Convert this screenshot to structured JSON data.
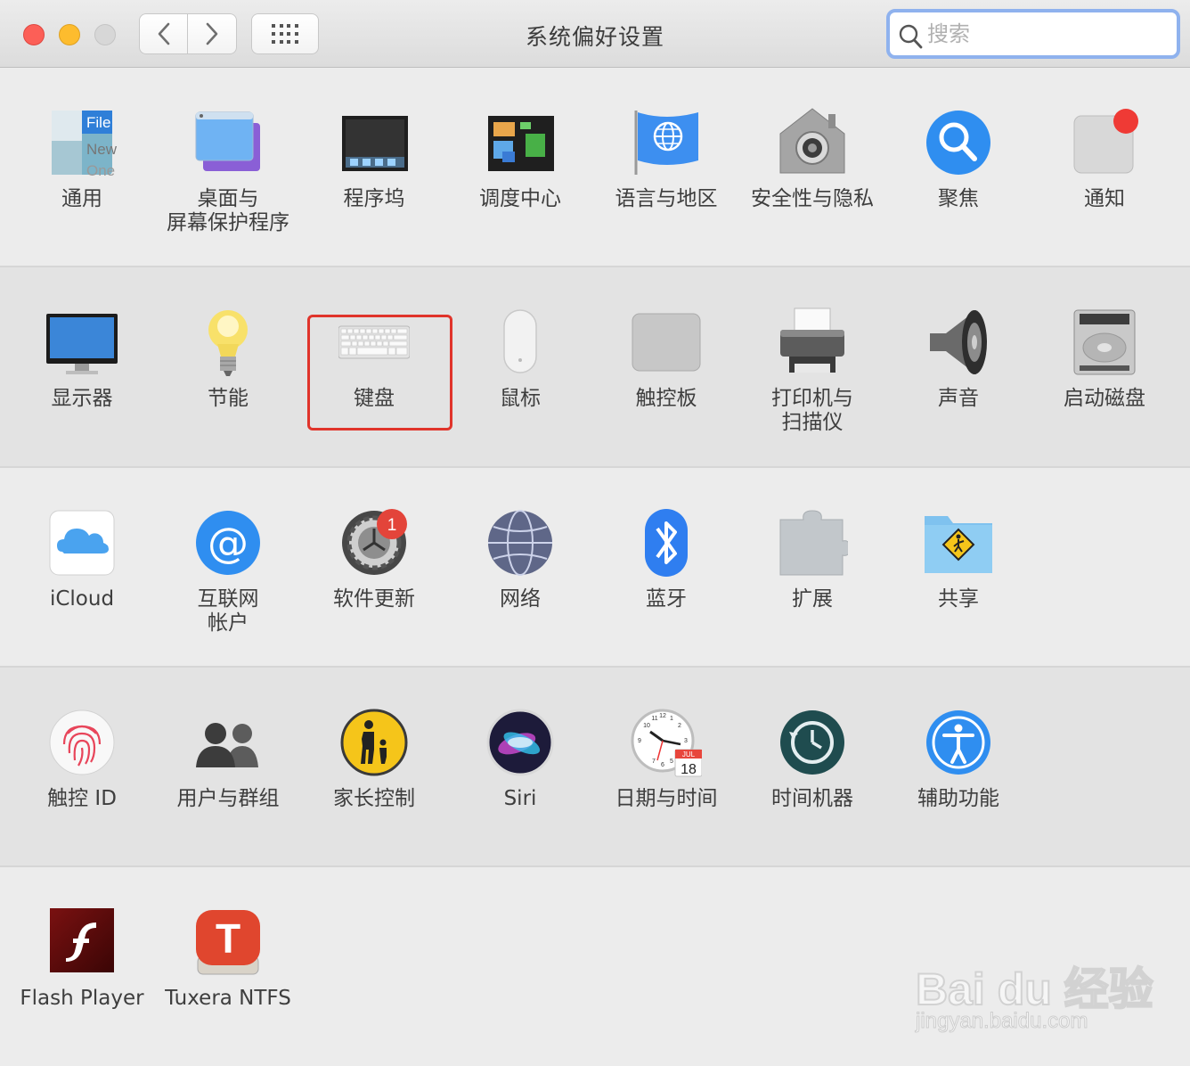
{
  "window": {
    "title": "系统偏好设置",
    "search_placeholder": "搜索"
  },
  "rows": [
    [
      {
        "label": "通用",
        "icon": "general-icon"
      },
      {
        "label": "桌面与\n屏幕保护程序",
        "icon": "desktop-screensaver-icon"
      },
      {
        "label": "程序坞",
        "icon": "dock-icon"
      },
      {
        "label": "调度中心",
        "icon": "mission-control-icon"
      },
      {
        "label": "语言与地区",
        "icon": "language-region-icon"
      },
      {
        "label": "安全性与隐私",
        "icon": "security-privacy-icon"
      },
      {
        "label": "聚焦",
        "icon": "spotlight-icon"
      },
      {
        "label": "通知",
        "icon": "notifications-icon"
      }
    ],
    [
      {
        "label": "显示器",
        "icon": "displays-icon"
      },
      {
        "label": "节能",
        "icon": "energy-saver-icon"
      },
      {
        "label": "键盘",
        "icon": "keyboard-icon"
      },
      {
        "label": "鼠标",
        "icon": "mouse-icon"
      },
      {
        "label": "触控板",
        "icon": "trackpad-icon"
      },
      {
        "label": "打印机与\n扫描仪",
        "icon": "printers-scanners-icon"
      },
      {
        "label": "声音",
        "icon": "sound-icon"
      },
      {
        "label": "启动磁盘",
        "icon": "startup-disk-icon"
      }
    ],
    [
      {
        "label": "iCloud",
        "icon": "icloud-icon"
      },
      {
        "label": "互联网\n帐户",
        "icon": "internet-accounts-icon"
      },
      {
        "label": "软件更新",
        "icon": "software-update-icon",
        "badge": "1"
      },
      {
        "label": "网络",
        "icon": "network-icon"
      },
      {
        "label": "蓝牙",
        "icon": "bluetooth-icon"
      },
      {
        "label": "扩展",
        "icon": "extensions-icon"
      },
      {
        "label": "共享",
        "icon": "sharing-icon"
      }
    ],
    [
      {
        "label": "触控 ID",
        "icon": "touch-id-icon"
      },
      {
        "label": "用户与群组",
        "icon": "users-groups-icon"
      },
      {
        "label": "家长控制",
        "icon": "parental-controls-icon"
      },
      {
        "label": "Siri",
        "icon": "siri-icon"
      },
      {
        "label": "日期与时间",
        "icon": "date-time-icon"
      },
      {
        "label": "时间机器",
        "icon": "time-machine-icon"
      },
      {
        "label": "辅助功能",
        "icon": "accessibility-icon"
      }
    ],
    [
      {
        "label": "Flash Player",
        "icon": "flash-player-icon"
      },
      {
        "label": "Tuxera NTFS",
        "icon": "tuxera-ntfs-icon"
      }
    ]
  ],
  "icon_text": {
    "general_lines": [
      "File",
      "New",
      "One"
    ],
    "calendar_month": "JUL",
    "calendar_day": "18",
    "clock_numbers": [
      "11",
      "12",
      "1",
      "10",
      "2",
      "9",
      "3",
      "7",
      "6",
      "5"
    ]
  },
  "highlighted_pane": "keyboard-icon",
  "watermark": {
    "brand": "Bai du 经验",
    "url": "jingyan.baidu.com"
  },
  "colors": {
    "highlight": "#e0342b",
    "search_focus": "#8fb2ee"
  }
}
